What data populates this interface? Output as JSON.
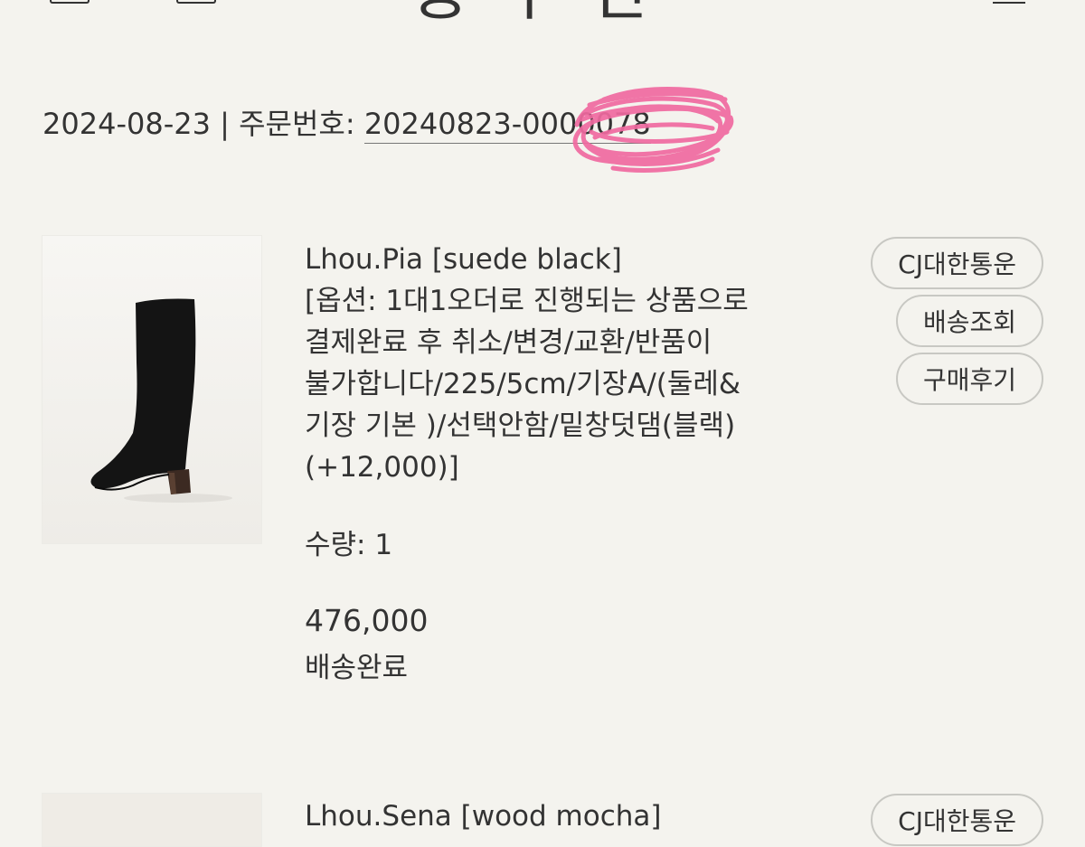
{
  "header": {
    "title_partial": "송 수 신",
    "left_icons": [
      "box-icon",
      "box-icon"
    ],
    "right_icon": "menu-icon"
  },
  "order": {
    "date": "2024-08-23",
    "separator": "|",
    "order_number_label": "주문번호:",
    "order_number": "20240823-0000078",
    "redaction_color": "#f06aa0"
  },
  "products": [
    {
      "name": "Lhou.Pia [suede black]",
      "option": "[옵션: 1대1오더로 진행되는 상품으로 결제완료 후 취소/변경/교환/반품이 불가합니다/225/5cm/기장A/(둘레&기장 기본 )/선택안함/밑창덧댐(블랙) (+12,000)]",
      "quantity": "수량: 1",
      "price": "476,000",
      "status": "배송완료",
      "buttons": {
        "carrier": "CJ대한통운",
        "tracking": "배송조회",
        "review": "구매후기"
      }
    },
    {
      "name": "Lhou.Sena [wood mocha]",
      "buttons": {
        "carrier": "CJ대한통운"
      }
    }
  ]
}
